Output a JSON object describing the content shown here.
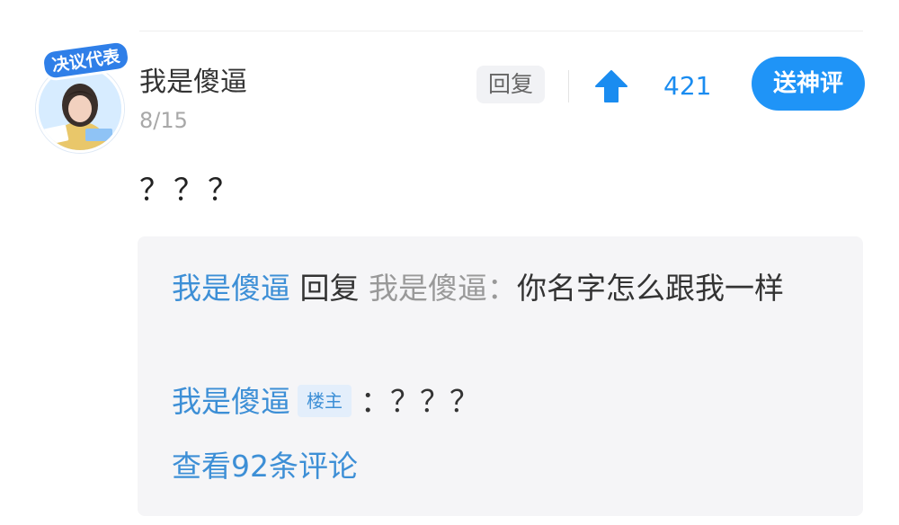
{
  "post": {
    "username": "我是傻逼",
    "date": "8/15",
    "content": "？？？",
    "avatar_badge_text": "决议代表",
    "actions": {
      "reply_label": "回复",
      "upvote_count": "421",
      "god_comment_label": "送神评"
    }
  },
  "replies": {
    "reply1": {
      "author": "我是傻逼",
      "verb": "回复",
      "target": "我是傻逼：",
      "text": "你名字怎么跟我一样"
    },
    "reply2": {
      "author": "我是傻逼",
      "badge": "楼主",
      "text": "：？？？"
    },
    "more_link": "查看92条评论"
  },
  "icons": {
    "upvote": "arrow-up-icon"
  },
  "colors": {
    "accent": "#1f94f7",
    "link": "#3d8fd6",
    "muted": "#999999",
    "reply_bg": "#f5f5f7"
  }
}
